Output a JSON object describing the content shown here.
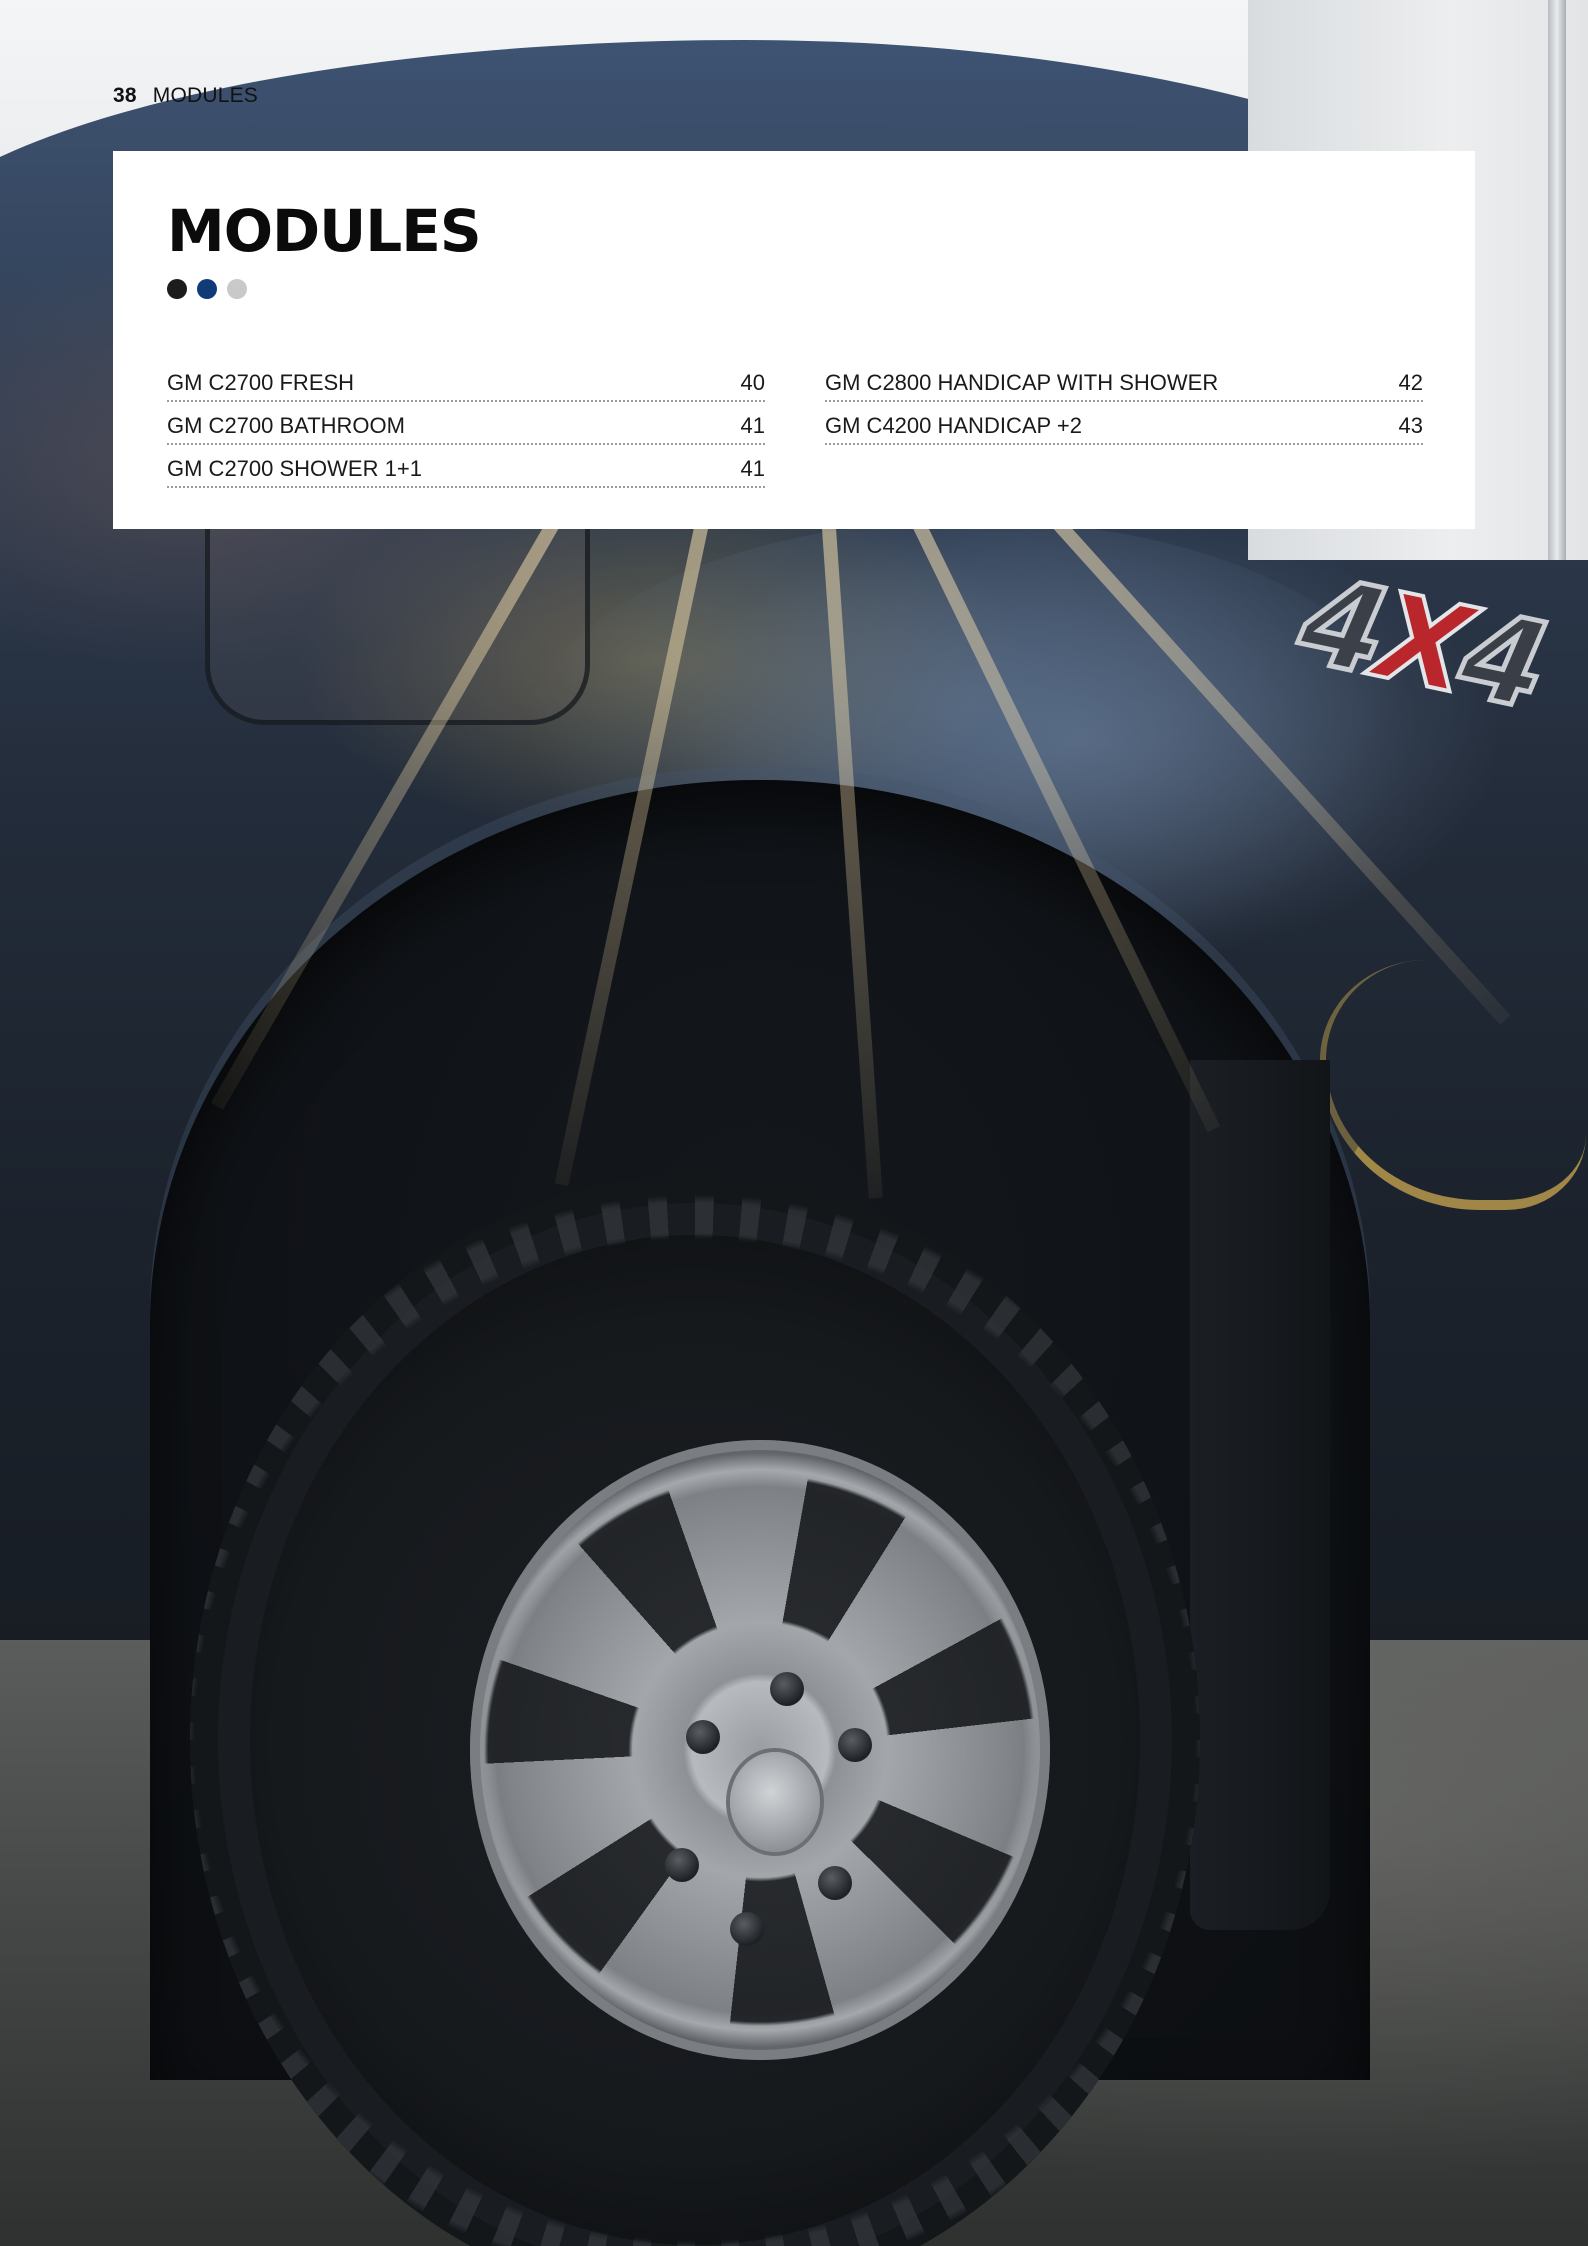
{
  "header": {
    "page_number": "38",
    "section": "MODULES"
  },
  "card": {
    "title": "MODULES",
    "dots": [
      {
        "color": "#1c1c1c"
      },
      {
        "color": "#0f3c78"
      },
      {
        "color": "#c9c9c9"
      }
    ]
  },
  "toc": {
    "left": [
      {
        "label": "GM C2700 FRESH",
        "page": "40"
      },
      {
        "label": "GM C2700 BATHROOM",
        "page": "41"
      },
      {
        "label": "GM C2700 SHOWER 1+1",
        "page": "41"
      }
    ],
    "right": [
      {
        "label": "GM C2800 HANDICAP WITH SHOWER",
        "page": "42"
      },
      {
        "label": "GM C4200 HANDICAP +2",
        "page": "43"
      }
    ]
  },
  "photo": {
    "badge": {
      "prefix": "4",
      "x": "X",
      "suffix": "4"
    }
  }
}
